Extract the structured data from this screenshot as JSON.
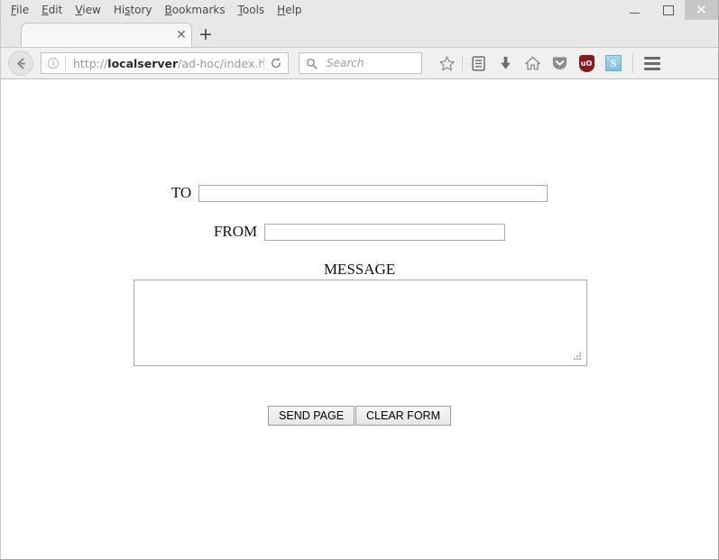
{
  "window": {
    "controls": {
      "minimize_label": "Minimize",
      "maximize_label": "Maximize",
      "close_label": "✕"
    }
  },
  "menubar": {
    "items": [
      {
        "label": "File",
        "accesskey": "F"
      },
      {
        "label": "Edit",
        "accesskey": "E"
      },
      {
        "label": "View",
        "accesskey": "V"
      },
      {
        "label": "History",
        "accesskey": "s"
      },
      {
        "label": "Bookmarks",
        "accesskey": "B"
      },
      {
        "label": "Tools",
        "accesskey": "T"
      },
      {
        "label": "Help",
        "accesskey": "H"
      }
    ]
  },
  "tabstrip": {
    "tab_title": "",
    "close_glyph": "✕",
    "newtab_glyph": "+"
  },
  "navbar": {
    "back_label": "Back",
    "identity_label": "Site information",
    "url": {
      "scheme": "http://",
      "host": "localserver",
      "path": "/ad-hoc/index.htm",
      "full": "http://localserver/ad-hoc/index.htm"
    },
    "reload_label": "Reload",
    "search": {
      "value": "",
      "placeholder": "Search"
    },
    "icons": [
      {
        "name": "bookmark-star-icon",
        "label": "Bookmark this page"
      },
      {
        "name": "library-icon",
        "label": "Show your library"
      },
      {
        "name": "download-icon",
        "label": "Downloads"
      },
      {
        "name": "home-icon",
        "label": "Home"
      },
      {
        "name": "pocket-icon",
        "label": "Save to Pocket"
      },
      {
        "name": "ublock-origin-icon",
        "label": "uBlock Origin",
        "badge": "uO",
        "color": "#8b1a1a"
      },
      {
        "name": "s-extension-icon",
        "label": "S",
        "color": "#7fbfe0"
      }
    ],
    "menu_label": "Open menu"
  },
  "page": {
    "fields": [
      {
        "name": "to",
        "label": "TO",
        "value": "",
        "placeholder": ""
      },
      {
        "name": "from",
        "label": "FROM",
        "value": "",
        "placeholder": ""
      }
    ],
    "message": {
      "label": "MESSAGE",
      "value": "",
      "placeholder": ""
    },
    "buttons": [
      {
        "name": "send-page",
        "label": "SEND PAGE"
      },
      {
        "name": "clear-form",
        "label": "CLEAR FORM"
      }
    ]
  },
  "colors": {
    "chrome_bg": "#e8e8e8",
    "toolbar_bg": "#f0f0f0",
    "page_bg": "#ffffff",
    "border": "#a9a9a9",
    "ublock_red": "#8b1a1a",
    "s_blue": "#7fbfe0"
  }
}
